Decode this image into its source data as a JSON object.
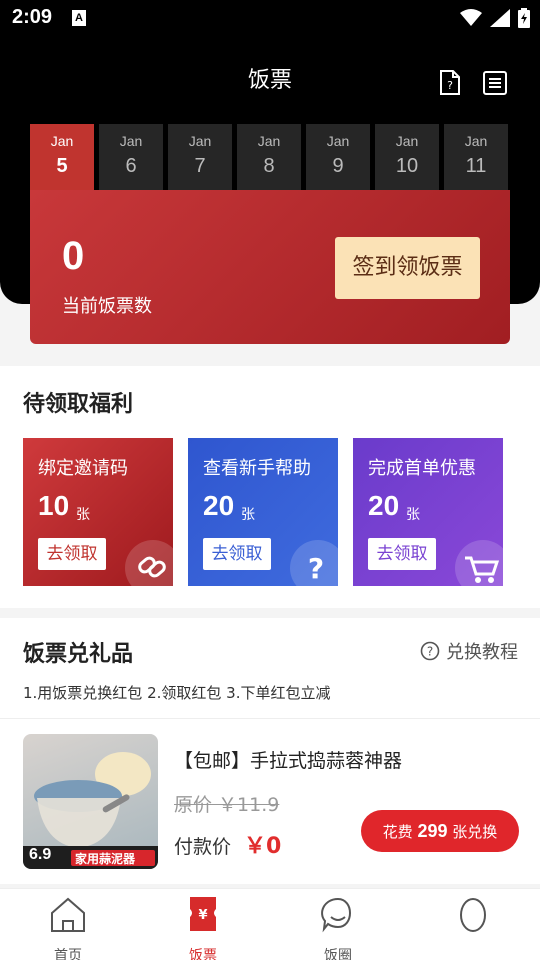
{
  "status": {
    "time": "2:09",
    "indicator": "A"
  },
  "header": {
    "title": "饭票",
    "help_icon": "document-question-icon",
    "list_icon": "list-icon"
  },
  "dates": [
    {
      "month": "Jan",
      "day": "5",
      "active": true
    },
    {
      "month": "Jan",
      "day": "6"
    },
    {
      "month": "Jan",
      "day": "7"
    },
    {
      "month": "Jan",
      "day": "8"
    },
    {
      "month": "Jan",
      "day": "9"
    },
    {
      "month": "Jan",
      "day": "10"
    },
    {
      "month": "Jan",
      "day": "11"
    }
  ],
  "ticket": {
    "count": "0",
    "label": "当前饭票数",
    "signin_label": "签到领饭票"
  },
  "benefits": {
    "title": "待领取福利",
    "items": [
      {
        "title": "绑定邀请码",
        "num": "10",
        "unit": "张",
        "button": "去领取",
        "icon": "link-icon",
        "color": "#c0342f"
      },
      {
        "title": "查看新手帮助",
        "num": "20",
        "unit": "张",
        "button": "去领取",
        "icon": "question-icon",
        "color": "#3a5fd4"
      },
      {
        "title": "完成首单优惠",
        "num": "20",
        "unit": "张",
        "button": "去领取",
        "icon": "cart-icon",
        "color": "#7a43d2"
      }
    ]
  },
  "gifts": {
    "title": "饭票兑礼品",
    "tutorial": "兑换教程",
    "steps": "1.用饭票兑换红包 2.领取红包 3.下单红包立减",
    "product": {
      "name": "【包邮】手拉式捣蒜蓉神器",
      "original": "原价 ￥11.9",
      "pay_label": "付款价",
      "pay_price": "￥0",
      "redeem_prefix": "花费",
      "redeem_count": "299",
      "redeem_suffix": "张兑换",
      "img_price": "6.9",
      "img_caption": "家用蒜泥器"
    }
  },
  "tabs": [
    {
      "label": "首页",
      "icon": "home-icon"
    },
    {
      "label": "饭票",
      "icon": "ticket-icon",
      "active": true
    },
    {
      "label": "饭圈",
      "icon": "chat-bubble-icon"
    },
    {
      "label": "",
      "icon": "profile-icon"
    }
  ],
  "colors": {
    "accent": "#d62b2b",
    "header_bg": "#000000",
    "gold": "#fbe2b6"
  }
}
